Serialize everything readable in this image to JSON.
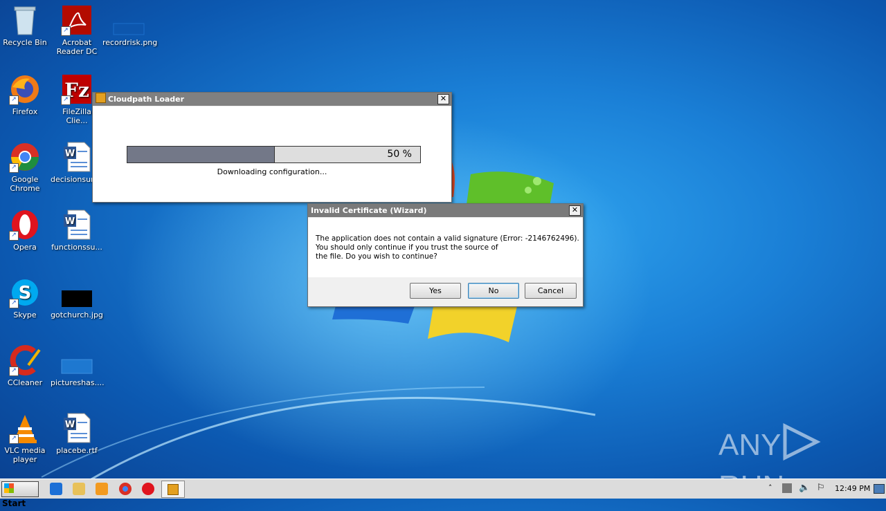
{
  "desktop_icons": [
    {
      "label": "Recycle Bin"
    },
    {
      "label": "Acrobat Reader DC"
    },
    {
      "label": "recordrisk.png"
    },
    {
      "label": "Firefox"
    },
    {
      "label": "FileZilla Clie..."
    },
    {
      "label": "Google Chrome"
    },
    {
      "label": "decisionsurv..."
    },
    {
      "label": "Opera"
    },
    {
      "label": "functionssu..."
    },
    {
      "label": "Skype"
    },
    {
      "label": "gotchurch.jpg"
    },
    {
      "label": "CCleaner"
    },
    {
      "label": "pictureshas...."
    },
    {
      "label": "VLC media player"
    },
    {
      "label": "placebe.rtf"
    }
  ],
  "loader_window": {
    "title": "Cloudpath Loader",
    "progress_text": "50 %",
    "progress_fraction": 0.5,
    "status": "Downloading configuration..."
  },
  "cert_dialog": {
    "title": "Invalid Certificate (Wizard)",
    "message_line1": "The application does not contain a valid signature (Error: -2146762496).",
    "message_line2": "You should only continue if you trust the source of",
    "message_line3": "the file.  Do you wish to continue?",
    "yes_label": "Yes",
    "no_label": "No",
    "cancel_label": "Cancel"
  },
  "taskbar": {
    "start_label": "Start",
    "clock": "12:49 PM"
  },
  "watermark": {
    "text_left": "ANY",
    "text_right": "RUN"
  },
  "colors": {
    "progress_fill": "#737888",
    "progress_empty": "#dedede",
    "titlebar_gray": "#808080"
  }
}
